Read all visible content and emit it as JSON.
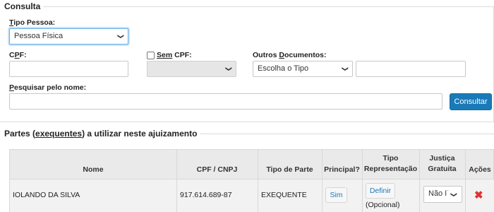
{
  "consulta": {
    "legend": "Consulta",
    "tipo_pessoa": {
      "label_u": "T",
      "label_rest": "ipo Pessoa:",
      "value": "Pessoa Física"
    },
    "cpf": {
      "label_pre": "C",
      "label_u": "P",
      "label_post": "F:",
      "value": ""
    },
    "sem_cpf": {
      "label_u": "Sem",
      "label_rest": " CPF:",
      "checked": false,
      "select_value": ""
    },
    "outros": {
      "label_pre": "Outros ",
      "label_u": "D",
      "label_post": "ocumentos:",
      "select_value": "Escolha o Tipo",
      "input_value": ""
    },
    "pesquisar": {
      "label_u": "P",
      "label_rest": "esquisar pelo nome:",
      "value": ""
    },
    "consultar_label": "Consultar"
  },
  "partes": {
    "legend_pre": "Partes (",
    "legend_u": "exequentes",
    "legend_post": ") a utilizar neste ajuizamento",
    "columns": {
      "nome": "Nome",
      "cpf_cnpj": "CPF / CNPJ",
      "tipo_parte": "Tipo de Parte",
      "principal": "Principal?",
      "tipo_rep_1": "Tipo",
      "tipo_rep_2": "Representação",
      "justica_1": "Justiça",
      "justica_2": "Gratuita",
      "acoes": "Ações"
    },
    "rows": [
      {
        "nome": "IOLANDO DA SILVA",
        "cpf_cnpj": "917.614.689-87",
        "tipo_parte": "EXEQUENTE",
        "principal": "Sim",
        "definir": "Definir",
        "opcional": "(Opcional)",
        "justica_value": "Não R"
      }
    ]
  }
}
